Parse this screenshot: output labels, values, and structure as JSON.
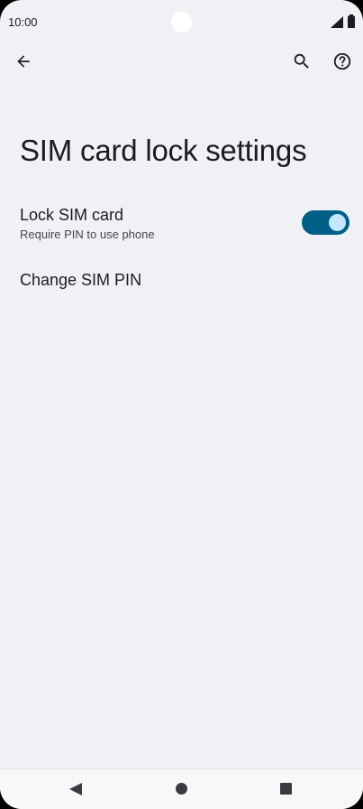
{
  "status_bar": {
    "time": "10:00",
    "icons": [
      "signal-icon",
      "battery-icon"
    ]
  },
  "toolbar": {
    "back_icon": "arrow-left-icon",
    "search_icon": "search-icon",
    "help_icon": "help-circle-icon"
  },
  "page": {
    "title": "SIM card lock settings"
  },
  "settings": {
    "lock_sim": {
      "title": "Lock SIM card",
      "summary": "Require PIN to use phone",
      "enabled": true
    },
    "change_pin": {
      "title": "Change SIM PIN"
    }
  },
  "nav_bar": {
    "icons": [
      "nav-back-icon",
      "nav-home-icon",
      "nav-recents-icon"
    ]
  },
  "colors": {
    "background": "#f0f1f4",
    "toggle_track": "#005f87",
    "toggle_thumb": "#c4e7ff",
    "text_primary": "#1b1c1f",
    "text_secondary": "#45474c"
  }
}
